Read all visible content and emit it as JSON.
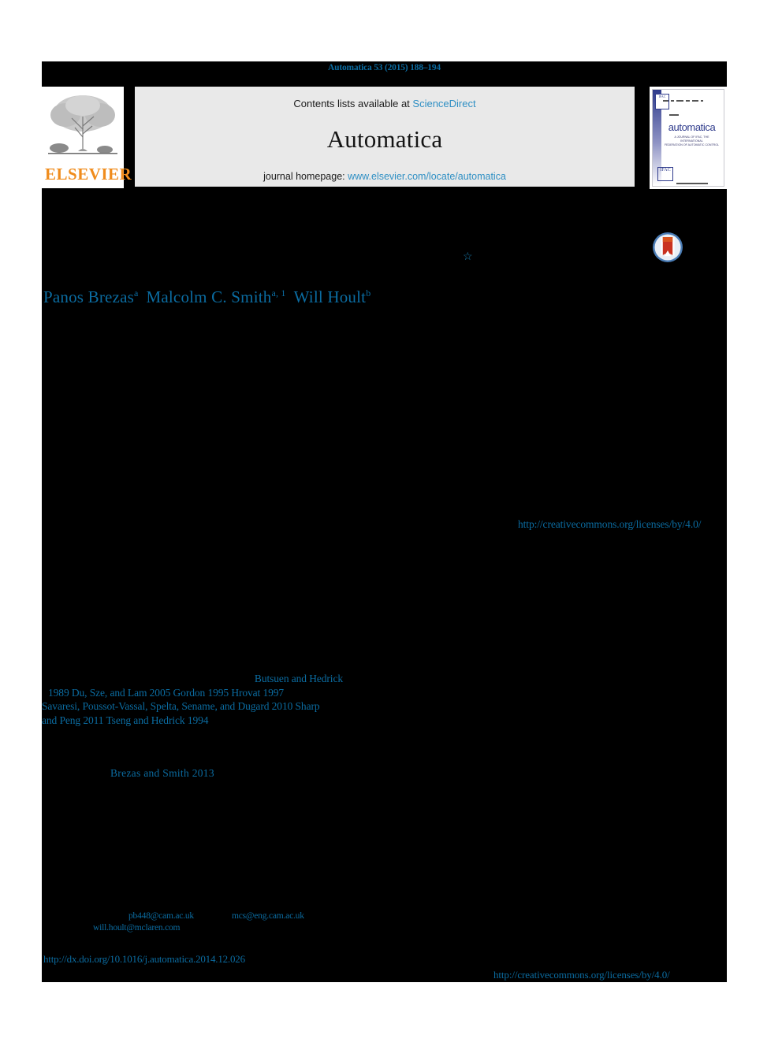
{
  "running_head": "Automatica 53 (2015) 188–194",
  "masthead": {
    "publisher_logo_name": "elsevier-tree-logo",
    "publisher_wordmark": "ELSEVIER",
    "contents_prefix": "Contents lists available at ",
    "contents_link": "ScienceDirect",
    "journal_title": "Automatica",
    "homepage_prefix": "journal homepage: ",
    "homepage_link": "www.elsevier.com/locate/automatica",
    "cover": {
      "journal_name": "automatica",
      "subtitle_line1": "A JOURNAL OF IFAC, THE INTERNATIONAL",
      "subtitle_line2": "FEDERATION OF AUTOMATIC CONTROL",
      "header_meta": "VOLUME 53  •  NUMBER 3  •  MARCH 2015",
      "header_issn": "ISSN 0005-1098",
      "publisher_mark": "IFAC"
    }
  },
  "badges": {
    "crossmark_label": "CrossMark",
    "title_footnote_marker": "☆"
  },
  "authors": {
    "a1_name": "Panos Brezas",
    "a1_sup": "a",
    "a2_name": "Malcolm C. Smith",
    "a2_sup": "a, 1",
    "a3_name": "Will Hoult",
    "a3_sup": "b"
  },
  "links": {
    "license_url": "http://creativecommons.org/licenses/by/4.0/",
    "doi_url": "http://dx.doi.org/10.1016/j.automatica.2014.12.026"
  },
  "citations": {
    "line1": "Butsuen and Hedrick",
    "line2": "1989    Du, Sze, and Lam   2005    Gordon   1995    Hrovat   1997",
    "line3": "Savaresi, Poussot-Vassal, Spelta, Sename, and Dugard  2010   Sharp",
    "line4": "and Peng   2011          Tseng and Hedrick   1994",
    "brezas_smith": "Brezas and Smith   2013"
  },
  "footnote": {
    "email_1": "pb448@cam.ac.uk",
    "email_2": "mcs@eng.cam.ac.uk",
    "email_3": "will.hoult@mclaren.com"
  },
  "colors": {
    "link_blue": "#0b6ca1",
    "masthead_link_blue": "#2e8fc4",
    "band_grey": "#e9e9e9",
    "elsevier_orange": "#f08c1c",
    "redaction_black": "#000000",
    "cover_blue": "#2f3b8c"
  }
}
